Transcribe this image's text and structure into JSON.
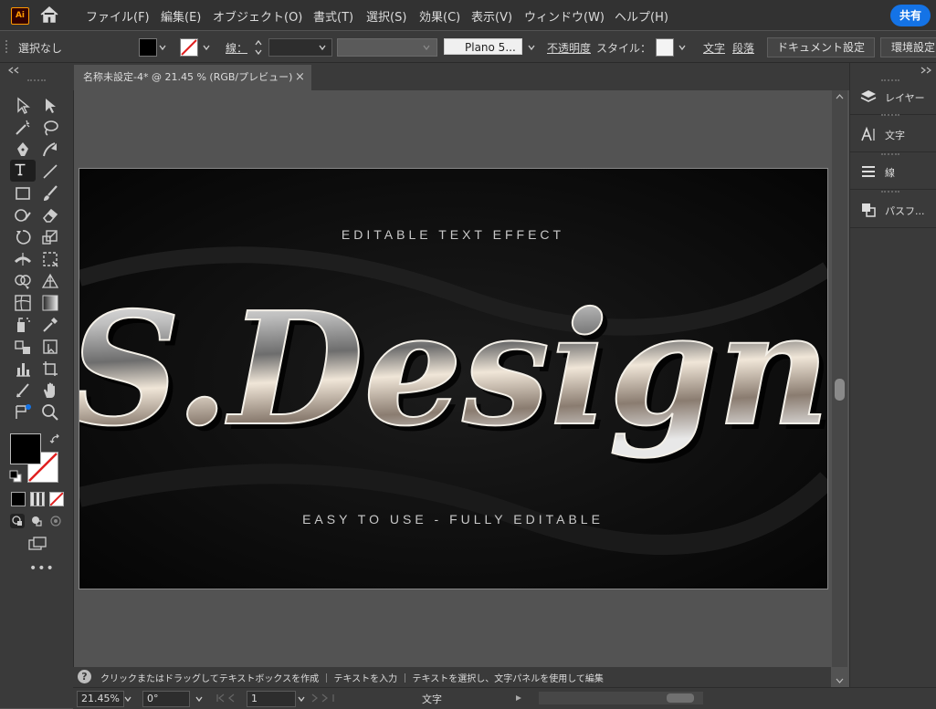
{
  "app": {
    "logo": "Ai",
    "share_label": "共有"
  },
  "menu": [
    "ファイル(F)",
    "編集(E)",
    "オブジェクト(O)",
    "書式(T)",
    "選択(S)",
    "効果(C)",
    "表示(V)",
    "ウィンドウ(W)",
    "ヘルプ(H)"
  ],
  "control": {
    "selection_label": "選択なし",
    "stroke_label": "線：",
    "font_name": "Plano 5...",
    "opacity_label": "不透明度",
    "style_label": "スタイル：",
    "char_label": "文字",
    "para_label": "段落",
    "doc_setup_label": "ドキュメント設定",
    "prefs_label": "環境設定"
  },
  "document": {
    "tab_title": "名称未設定-4* @ 21.45 % (RGB/プレビュー)",
    "close_glyph": "×"
  },
  "artwork": {
    "top_line": "EDITABLE TEXT EFFECT",
    "main_text": "S.Design",
    "bottom_line": "EASY TO USE - FULLY EDITABLE"
  },
  "panels": [
    {
      "icon": "layers-icon",
      "label": "レイヤー"
    },
    {
      "icon": "type-icon",
      "label": "文字"
    },
    {
      "icon": "stroke-icon",
      "label": "線"
    },
    {
      "icon": "pathfinder-icon",
      "label": "パスフ..."
    }
  ],
  "hint": {
    "text": "クリックまたはドラッグしてテキストボックスを作成 ｜ テキストを入力 ｜ テキストを選択し、文字パネルを使用して編集"
  },
  "status": {
    "zoom": "21.45%",
    "rotation": "0°",
    "artboard_index": "1",
    "tool_name": "文字"
  },
  "colors": {
    "accent": "#1473e6",
    "app_bg": "#535353",
    "panel_bg": "#3a3a3a",
    "artboard_bg": "#0b0b0b"
  }
}
